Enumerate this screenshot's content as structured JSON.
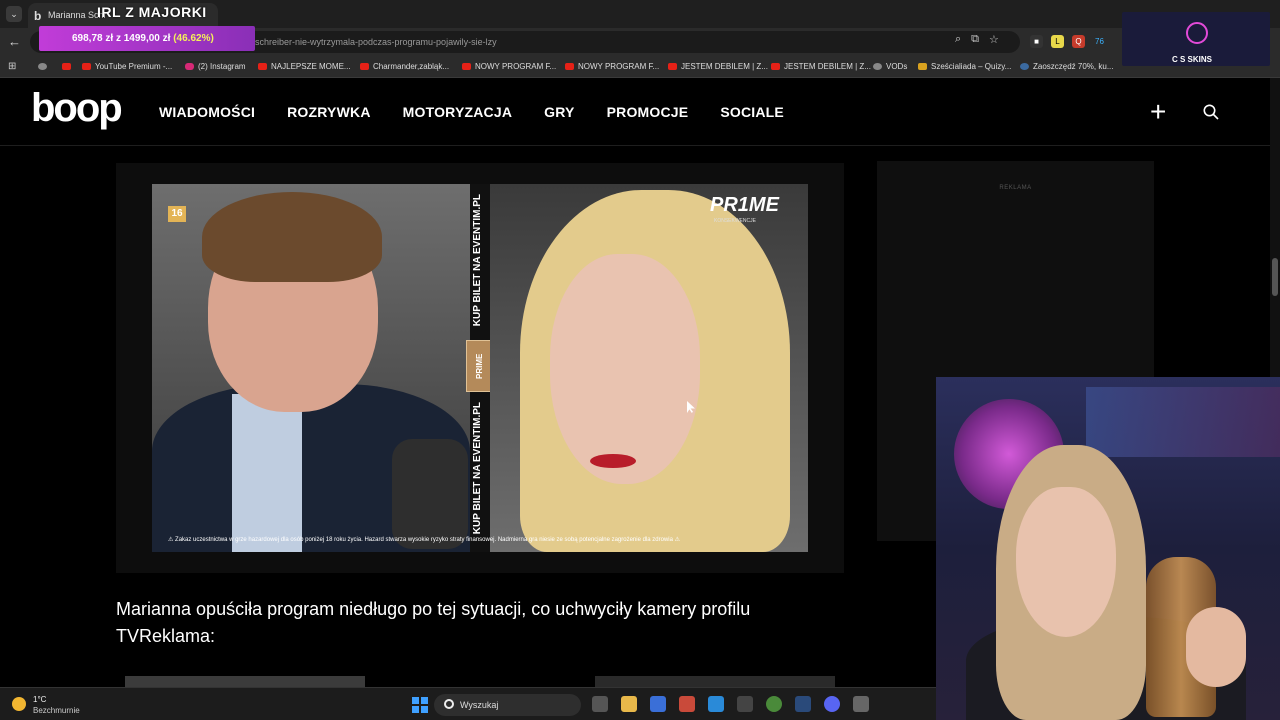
{
  "browser": {
    "tab_title": "Marianna Schr",
    "overlay_title": "IRL Z MAJORKI",
    "url": "schreiber-nie-wytrzymala-podczas-programu-pojawily-sie-lzy",
    "donation": {
      "amount": "698,78 zł",
      "separator": "z",
      "goal": "1499,00 zł",
      "percent": "(46.62%)",
      "progress": 0.4662
    },
    "bookmarks": [
      "YouTube Premium -...",
      "(2) Instagram",
      "NAJLEPSZE MOME...",
      "Charmander,zabląk...",
      "NOWY PROGRAM F...",
      "NOWY PROGRAM F...",
      "JESTEM DEBILEM | Z...",
      "JESTEM DEBILEM | Z...",
      "VODs",
      "Sześcialiada – Quizy...",
      "Zaoszczędź 70%, ku..."
    ],
    "skins_widget": "C S SKINS"
  },
  "site": {
    "logo": "boop",
    "nav": [
      "WIADOMOŚCI",
      "ROZRYWKA",
      "MOTORYZACJA",
      "GRY",
      "PROMOCJE",
      "SOCIALE"
    ]
  },
  "video": {
    "age_badge": "16",
    "prime": "PR1ME",
    "prime_sub": "KONSEKWENCJE",
    "banner_top": "KUP BILET NA EVENTIM.PL",
    "banner_bottom": "KUP BILET NA EVENTIM.PL",
    "banner_logo": "PRIME",
    "warning": "⚠ Zakaz uczestnictwa w grze hazardowej dla osób poniżej 18 roku życia. Hazard stwarza wysokie ryzyko straty finansowej. Nadmierna gra niesie ze sobą potencjalne zagrożenie dla zdrowia ⚠"
  },
  "ad": {
    "label": "REKLAMA"
  },
  "article": {
    "paragraph": "Marianna opuściła program niedługo po tej sytuacji, co uchwyciły kamery profilu TVReklama:"
  },
  "taskbar": {
    "temperature": "1°C",
    "weather": "Bezchmurnie",
    "search_placeholder": "Wyszukaj"
  },
  "colors": {
    "donation_gradient_start": "#c13cd8",
    "donation_percent": "#f4f15a",
    "windows_blue": "#3fa0ff"
  }
}
